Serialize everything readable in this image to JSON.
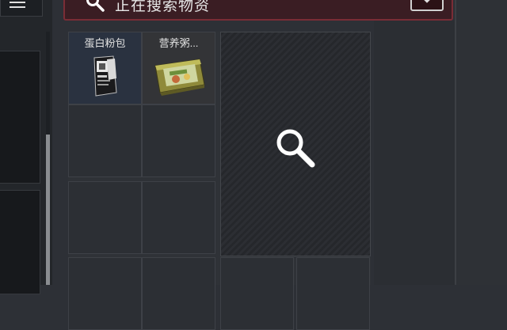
{
  "search_header": {
    "status_text": "正在搜索物资",
    "icon": "search-icon",
    "dropdown_icon": "chevron-down-icon"
  },
  "left_panel": {
    "menu_icon": "menu-icon"
  },
  "container": {
    "items": [
      {
        "label": "蛋白粉包",
        "icon": "protein-powder-pack-icon"
      },
      {
        "label": "营养粥...",
        "icon": "nutrition-porridge-tin-icon"
      }
    ],
    "searching_icon": "magnifier-icon"
  },
  "colors": {
    "header_accent": "#7a2d36",
    "header_bg": "#3a1d23",
    "item_cell_bg": "#2a3240"
  }
}
